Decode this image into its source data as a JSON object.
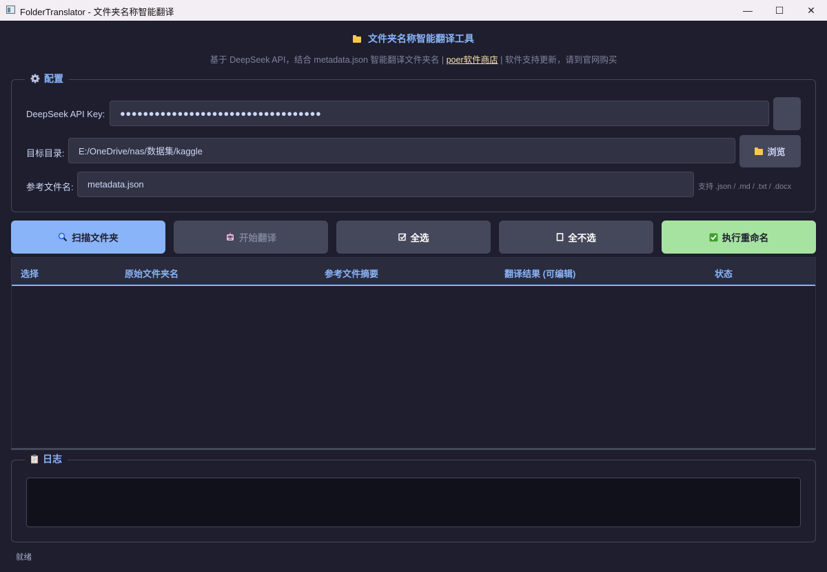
{
  "window": {
    "title": "FolderTranslator - 文件夹名称智能翻译",
    "minimize": "—",
    "maximize": "☐",
    "close": "✕"
  },
  "header": {
    "title": "文件夹名称智能翻译工具",
    "subtitle_prefix": "基于 DeepSeek API，结合 metadata.json 智能翻译文件夹名 | ",
    "subtitle_link": "poer软件商店",
    "subtitle_suffix": " | 软件支持更新，请到官网购买"
  },
  "config": {
    "legend": "配置",
    "api_key_label": "DeepSeek API Key:",
    "api_key_value": "●●●●●●●●●●●●●●●●●●●●●●●●●●●●●●●●●●●",
    "target_dir_label": "目标目录:",
    "target_dir_value": "E:/OneDrive/nas/数据集/kaggle",
    "browse_label": "浏览",
    "ref_file_label": "参考文件名:",
    "ref_file_value": "metadata.json",
    "ref_hint": "支持 .json / .md / .txt / .docx"
  },
  "actions": {
    "scan": "扫描文件夹",
    "translate": "开始翻译",
    "select_all": "全选",
    "select_none": "全不选",
    "rename": "执行重命名"
  },
  "table": {
    "columns": [
      "选择",
      "原始文件夹名",
      "参考文件摘要",
      "翻译结果 (可编辑)",
      "状态"
    ],
    "rows": []
  },
  "log": {
    "legend": "日志"
  },
  "status": {
    "text": "就绪"
  },
  "colors": {
    "background": "#1e1e2e",
    "accent": "#89b4fa",
    "success": "#a6e3a1",
    "surface": "#313244"
  }
}
